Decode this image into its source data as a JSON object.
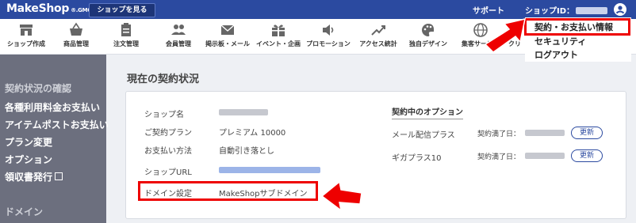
{
  "topbar": {
    "logo": "MakeShop",
    "logo_suffix": "®.GMO",
    "shop_button": "ショップを見る",
    "support": "サポート",
    "shop_id_label": "ショップID：",
    "accent": "#2b4aa0"
  },
  "nav": [
    {
      "label": "ショップ作成",
      "icon": "storefront-icon"
    },
    {
      "label": "商品管理",
      "icon": "basket-icon"
    },
    {
      "label": "注文管理",
      "icon": "clipboard-icon"
    },
    {
      "label": "会員管理",
      "icon": "people-icon"
    },
    {
      "label": "掲示板・メール",
      "icon": "mail-icon"
    },
    {
      "label": "イベント・企画",
      "icon": "gift-icon"
    },
    {
      "label": "プロモーション",
      "icon": "speaker-icon"
    },
    {
      "label": "アクセス統計",
      "icon": "trend-icon"
    },
    {
      "label": "独自デザイン",
      "icon": "palette-icon"
    },
    {
      "label": "集客サービス",
      "icon": "globe-icon"
    },
    {
      "label": "クリ",
      "icon": "globe-icon"
    }
  ],
  "dropdown": {
    "items": [
      "契約・お支払い情報",
      "セキュリティ",
      "ログアウト"
    ]
  },
  "sidebar": {
    "section1": "契約状況の確認",
    "links": [
      "各種利用料金お支払い",
      "アイテムポストお支払い",
      "プラン変更",
      "オプション",
      "領収書発行"
    ],
    "section2": "ドメイン"
  },
  "main": {
    "title": "現在の契約状況",
    "rows": [
      {
        "label": "ショップ名",
        "value": ""
      },
      {
        "label": "ご契約プラン",
        "value": "プレミアム 10000"
      },
      {
        "label": "お支払い方法",
        "value": "自動引き落とし"
      },
      {
        "label": "ショップURL",
        "value": ""
      },
      {
        "label": "ドメイン設定",
        "value": "MakeShopサブドメイン"
      }
    ],
    "options_title": "契約中のオプション",
    "options": [
      {
        "name": "メール配信プラス",
        "expiry_label": "契約満了日：",
        "button": "更新"
      },
      {
        "name": "ギガプラス10",
        "expiry_label": "契約満了日：",
        "button": "更新"
      }
    ]
  }
}
